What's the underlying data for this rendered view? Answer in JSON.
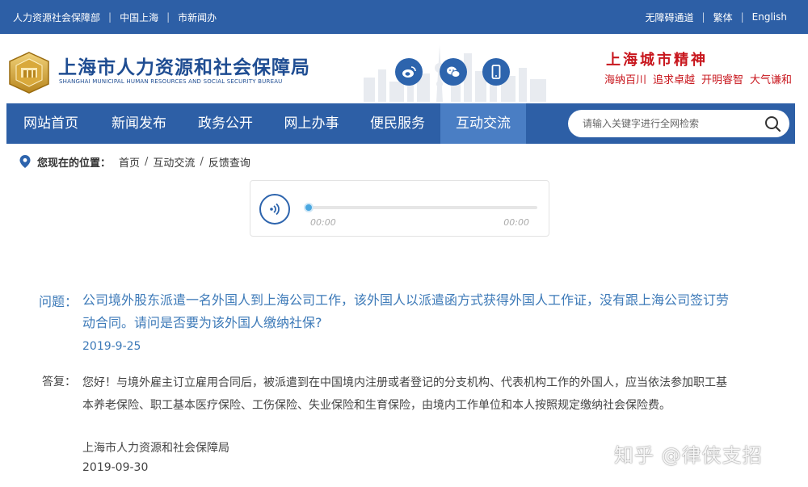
{
  "topbar": {
    "left_links": [
      "人力资源社会保障部",
      "中国上海",
      "市新闻办"
    ],
    "right_links": [
      "无障碍通道",
      "繁体",
      "English"
    ]
  },
  "header": {
    "title_cn": "上海市人力资源和社会保障局",
    "title_en": "SHANGHAI MUNICIPAL HUMAN RESOURCES AND SOCIAL SECURITY BUREAU",
    "social_icons": [
      "weibo-icon",
      "wechat-icon",
      "mobile-icon"
    ],
    "spirit_title": "上海城市精神",
    "spirit_words": [
      "海纳百川",
      "追求卓越",
      "开明睿智",
      "大气谦和"
    ]
  },
  "nav": {
    "items": [
      "网站首页",
      "新闻发布",
      "政务公开",
      "网上办事",
      "便民服务",
      "互动交流"
    ],
    "active_index": 5
  },
  "search": {
    "placeholder": "请输入关键字进行全网检索"
  },
  "breadcrumb": {
    "label": "您现在的位置：",
    "items": [
      "首页",
      "互动交流",
      "反馈查询"
    ]
  },
  "player": {
    "current_time": "00:00",
    "duration": "00:00",
    "progress": 0
  },
  "qa": {
    "question_label": "问题：",
    "question": "公司境外股东派遣一名外国人到上海公司工作，该外国人以派遣函方式获得外国人工作证，没有跟上海公司签订劳动合同。请问是否要为该外国人缴纳社保?",
    "question_date": "2019-9-25",
    "answer_label": "答复：",
    "answer": "您好！与境外雇主订立雇用合同后，被派遣到在中国境内注册或者登记的分支机构、代表机构工作的外国人，应当依法参加职工基本养老保险、职工基本医疗保险、工伤保险、失业保险和生育保险，由境内工作单位和本人按照规定缴纳社会保险费。",
    "answer_org": "上海市人力资源和社会保障局",
    "answer_date": "2019-09-30"
  },
  "watermark": "知乎 @律侠支招",
  "colors": {
    "brand_blue": "#2d5fa6",
    "nav_active": "#4a7ec4",
    "question_blue": "#3d7ab8",
    "spirit_red": "#c8161d"
  }
}
